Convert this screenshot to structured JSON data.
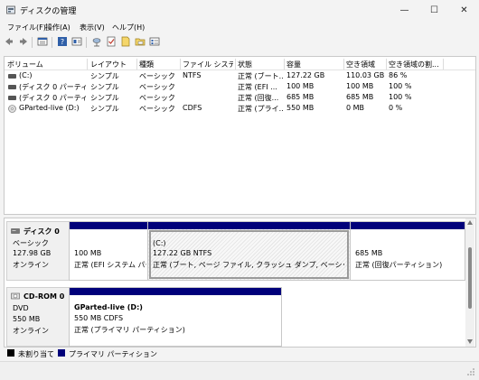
{
  "window": {
    "title": "ディスクの管理",
    "minimize_glyph": "—",
    "maximize_glyph": "☐",
    "close_glyph": "✕"
  },
  "menu": [
    "ファイル(F)",
    "操作(A)",
    "表示(V)",
    "ヘルプ(H)"
  ],
  "toolbar": {
    "icons": [
      "back-icon",
      "forward-icon",
      "disk-list-icon",
      "help-icon",
      "properties-icon",
      "connect-icon",
      "check-icon",
      "new-icon",
      "folder-icon",
      "settings-icon"
    ]
  },
  "volume_list": {
    "columns": [
      "ボリューム",
      "レイアウト",
      "種類",
      "ファイル システム",
      "状態",
      "容量",
      "空き領域",
      "空き領域の割..."
    ],
    "rows": [
      {
        "volume": "(C:)",
        "layout": "シンプル",
        "type": "ベーシック",
        "fs": "NTFS",
        "status": "正常 (ブート...",
        "capacity": "127.22 GB",
        "free": "110.03 GB",
        "pct": "86 %"
      },
      {
        "volume": "(ディスク 0 パーティショ...",
        "layout": "シンプル",
        "type": "ベーシック",
        "fs": "",
        "status": "正常 (EFI ...",
        "capacity": "100 MB",
        "free": "100 MB",
        "pct": "100 %"
      },
      {
        "volume": "(ディスク 0 パーティショ...",
        "layout": "シンプル",
        "type": "ベーシック",
        "fs": "",
        "status": "正常 (回復...",
        "capacity": "685 MB",
        "free": "685 MB",
        "pct": "100 %"
      },
      {
        "volume": "GParted-live (D:)",
        "layout": "シンプル",
        "type": "ベーシック",
        "fs": "CDFS",
        "status": "正常 (プライ...",
        "capacity": "550 MB",
        "free": "0 MB",
        "pct": "0 %"
      }
    ]
  },
  "disks": [
    {
      "name": "ディスク 0",
      "type": "ベーシック",
      "size": "127.98 GB",
      "state": "オンライン",
      "partitions": [
        {
          "title": "",
          "line1": "100 MB",
          "line2": "正常 (EFI システム パーテ"
        },
        {
          "title": "(C:)",
          "line1": "127.22 GB NTFS",
          "line2": "正常 (ブート, ページ ファイル, クラッシュ ダンプ, ベーシック データ パーテ"
        },
        {
          "title": "",
          "line1": "685 MB",
          "line2": "正常 (回復パーティション)"
        }
      ]
    },
    {
      "name": "CD-ROM 0",
      "type": "DVD",
      "size": "550 MB",
      "state": "オンライン",
      "partitions": [
        {
          "title": "GParted-live  (D:)",
          "line1": "550 MB CDFS",
          "line2": "正常 (プライマリ パーティション)"
        }
      ]
    }
  ],
  "legend": [
    {
      "label": "未割り当て",
      "color": "#000000"
    },
    {
      "label": "プライマリ パーティション",
      "color": "#00007a"
    }
  ]
}
